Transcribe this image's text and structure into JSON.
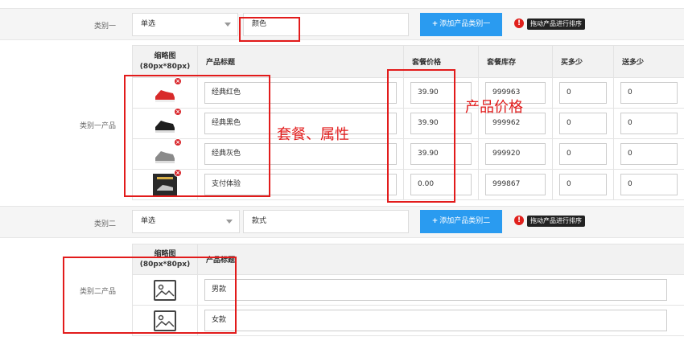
{
  "category1": {
    "label": "类别一",
    "select_value": "单选",
    "name_value": "颜色",
    "add_button": "添加产品类别一",
    "warn_icon": "!",
    "sort_tip": "拖动产品进行排序"
  },
  "category1_products": {
    "label": "类别一产品",
    "headers": {
      "thumb_line1": "缩略图",
      "thumb_line2": "(80px*80px)",
      "title": "产品标题",
      "price": "套餐价格",
      "stock": "套餐库存",
      "buy": "买多少",
      "gift": "送多少"
    },
    "rows": [
      {
        "title": "经典红色",
        "price": "39.90",
        "stock": "999963",
        "buy": "0",
        "gift": "0",
        "thumb_color": "#d82a2a"
      },
      {
        "title": "经典黑色",
        "price": "39.90",
        "stock": "999962",
        "buy": "0",
        "gift": "0",
        "thumb_color": "#1e1e1e"
      },
      {
        "title": "经典灰色",
        "price": "39.90",
        "stock": "999920",
        "buy": "0",
        "gift": "0",
        "thumb_color": "#8a8a8a"
      },
      {
        "title": "支付体验",
        "price": "0.00",
        "stock": "999867",
        "buy": "0",
        "gift": "0",
        "thumb_color": "#2a2a2a"
      }
    ],
    "delete_icon": "×"
  },
  "category2": {
    "label": "类别二",
    "select_value": "单选",
    "name_value": "款式",
    "add_button": "添加产品类别二",
    "warn_icon": "!",
    "sort_tip": "拖动产品进行排序"
  },
  "category2_products": {
    "label": "类别二产品",
    "headers": {
      "thumb_line1": "缩略图",
      "thumb_line2": "(80px*80px)",
      "title": "产品标题"
    },
    "rows": [
      {
        "title": "男款"
      },
      {
        "title": "女款"
      }
    ]
  },
  "annotations": {
    "package_attr": "套餐、属性",
    "product_price": "产品价格"
  },
  "colors": {
    "accent": "#2a9bf0",
    "annotation": "#e21b1b",
    "warn": "#e0201c"
  }
}
